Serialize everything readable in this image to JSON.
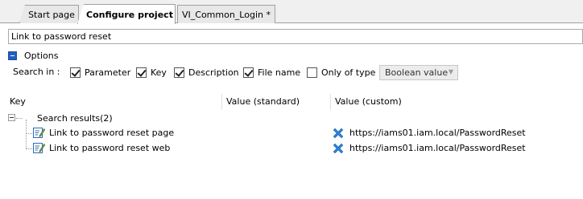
{
  "tabs": [
    {
      "label": "Start page"
    },
    {
      "label": "Configure project"
    },
    {
      "label": "VI_Common_Login *"
    }
  ],
  "search": {
    "value": "Link to password reset"
  },
  "options": {
    "label": "Options",
    "search_in_label": "Search in :",
    "checkboxes": [
      {
        "label": "Parameter",
        "checked": true
      },
      {
        "label": "Key",
        "checked": true
      },
      {
        "label": "Description",
        "checked": true
      },
      {
        "label": "File name",
        "checked": true
      },
      {
        "label": "Only of type",
        "checked": false
      }
    ],
    "type_select": {
      "value": "Boolean value"
    }
  },
  "grid": {
    "columns": [
      "Key",
      "Value (standard)",
      "Value (custom)"
    ],
    "group": {
      "label": "Search results(2)"
    },
    "rows": [
      {
        "key": "Link to password reset page",
        "value_standard": "",
        "value_custom": "https://iams01.iam.local/PasswordReset"
      },
      {
        "key": "Link to password reset web",
        "value_standard": "",
        "value_custom": "https://iams01.iam.local/PasswordReset"
      }
    ]
  },
  "colors": {
    "accent": "#1f5fbf",
    "delete_icon": "#2a7fd4",
    "doc_icon": "#2d6bb8"
  },
  "icons": {
    "collapse": "minus-square-icon",
    "doc": "edit-document-icon",
    "delete": "delete-x-icon"
  }
}
